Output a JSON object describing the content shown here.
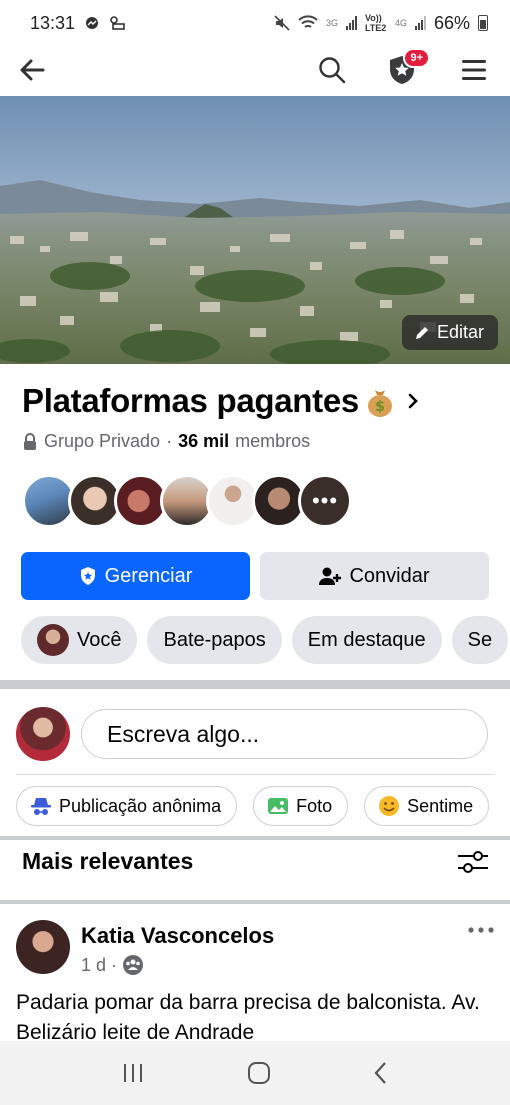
{
  "status_bar": {
    "time": "13:31",
    "net_3g": "3G",
    "volte": "Vo)) LTE2",
    "net_4g": "4G",
    "battery_percent": "66%"
  },
  "app_bar": {
    "back_icon": "arrow-left-icon",
    "search_icon": "search-icon",
    "admin_icon": "shield-star-icon",
    "admin_badge": "9+",
    "menu_icon": "hamburger-icon"
  },
  "cover": {
    "edit_label": "Editar"
  },
  "group": {
    "name": "Plataformas pagantes",
    "emoji": "money-bag",
    "privacy": "Grupo Privado",
    "separator": "·",
    "member_count": "36 mil",
    "member_label": "membros",
    "more_members": "•••"
  },
  "buttons": {
    "manage": "Gerenciar",
    "invite": "Convidar"
  },
  "chips": [
    "Você",
    "Bate-papos",
    "Em destaque",
    "Se"
  ],
  "composer": {
    "placeholder": "Escreva algo..."
  },
  "post_actions": [
    "Publicação anônima",
    "Foto",
    "Sentime"
  ],
  "feed": {
    "sort_title": "Mais relevantes"
  },
  "post": {
    "author": "Katia Vasconcelos",
    "time": "1 d",
    "dot": "·",
    "text": "Padaria pomar da barra precisa de balconista. Av. Belizário leite de Andrade"
  },
  "colors": {
    "primary": "#0866ff",
    "secondary_button": "#e4e6eb",
    "badge": "#e41e3f",
    "muted_text": "#65676b"
  }
}
